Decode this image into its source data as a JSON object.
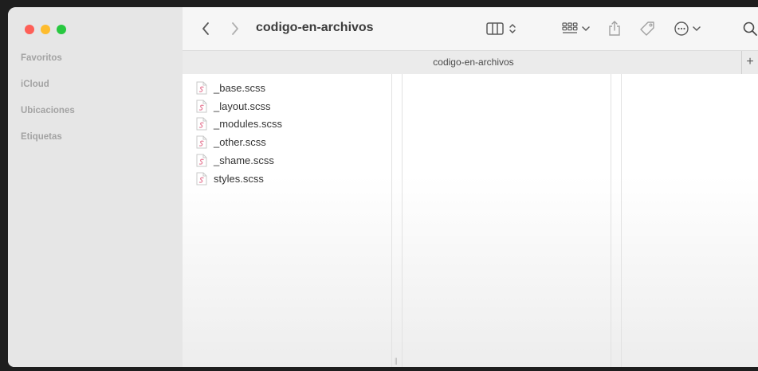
{
  "sidebar": {
    "sections": [
      {
        "label": "Favoritos"
      },
      {
        "label": "iCloud"
      },
      {
        "label": "Ubicaciones"
      },
      {
        "label": "Etiquetas"
      }
    ]
  },
  "toolbar": {
    "title": "codigo-en-archivos",
    "icons": [
      "back-icon",
      "forward-icon",
      "column-view-icon",
      "group-icon",
      "share-icon",
      "tag-icon",
      "more-icon",
      "search-icon"
    ]
  },
  "tabbar": {
    "tab_label": "codigo-en-archivos",
    "new_tab_label": "+"
  },
  "files": [
    {
      "name": "_base.scss"
    },
    {
      "name": "_layout.scss"
    },
    {
      "name": "_modules.scss"
    },
    {
      "name": "_other.scss"
    },
    {
      "name": "_shame.scss"
    },
    {
      "name": "styles.scss"
    }
  ],
  "colors": {
    "close": "#fe5f57",
    "minimize": "#febc2e",
    "maximize": "#28c840",
    "scss_icon": "#e8869f"
  }
}
